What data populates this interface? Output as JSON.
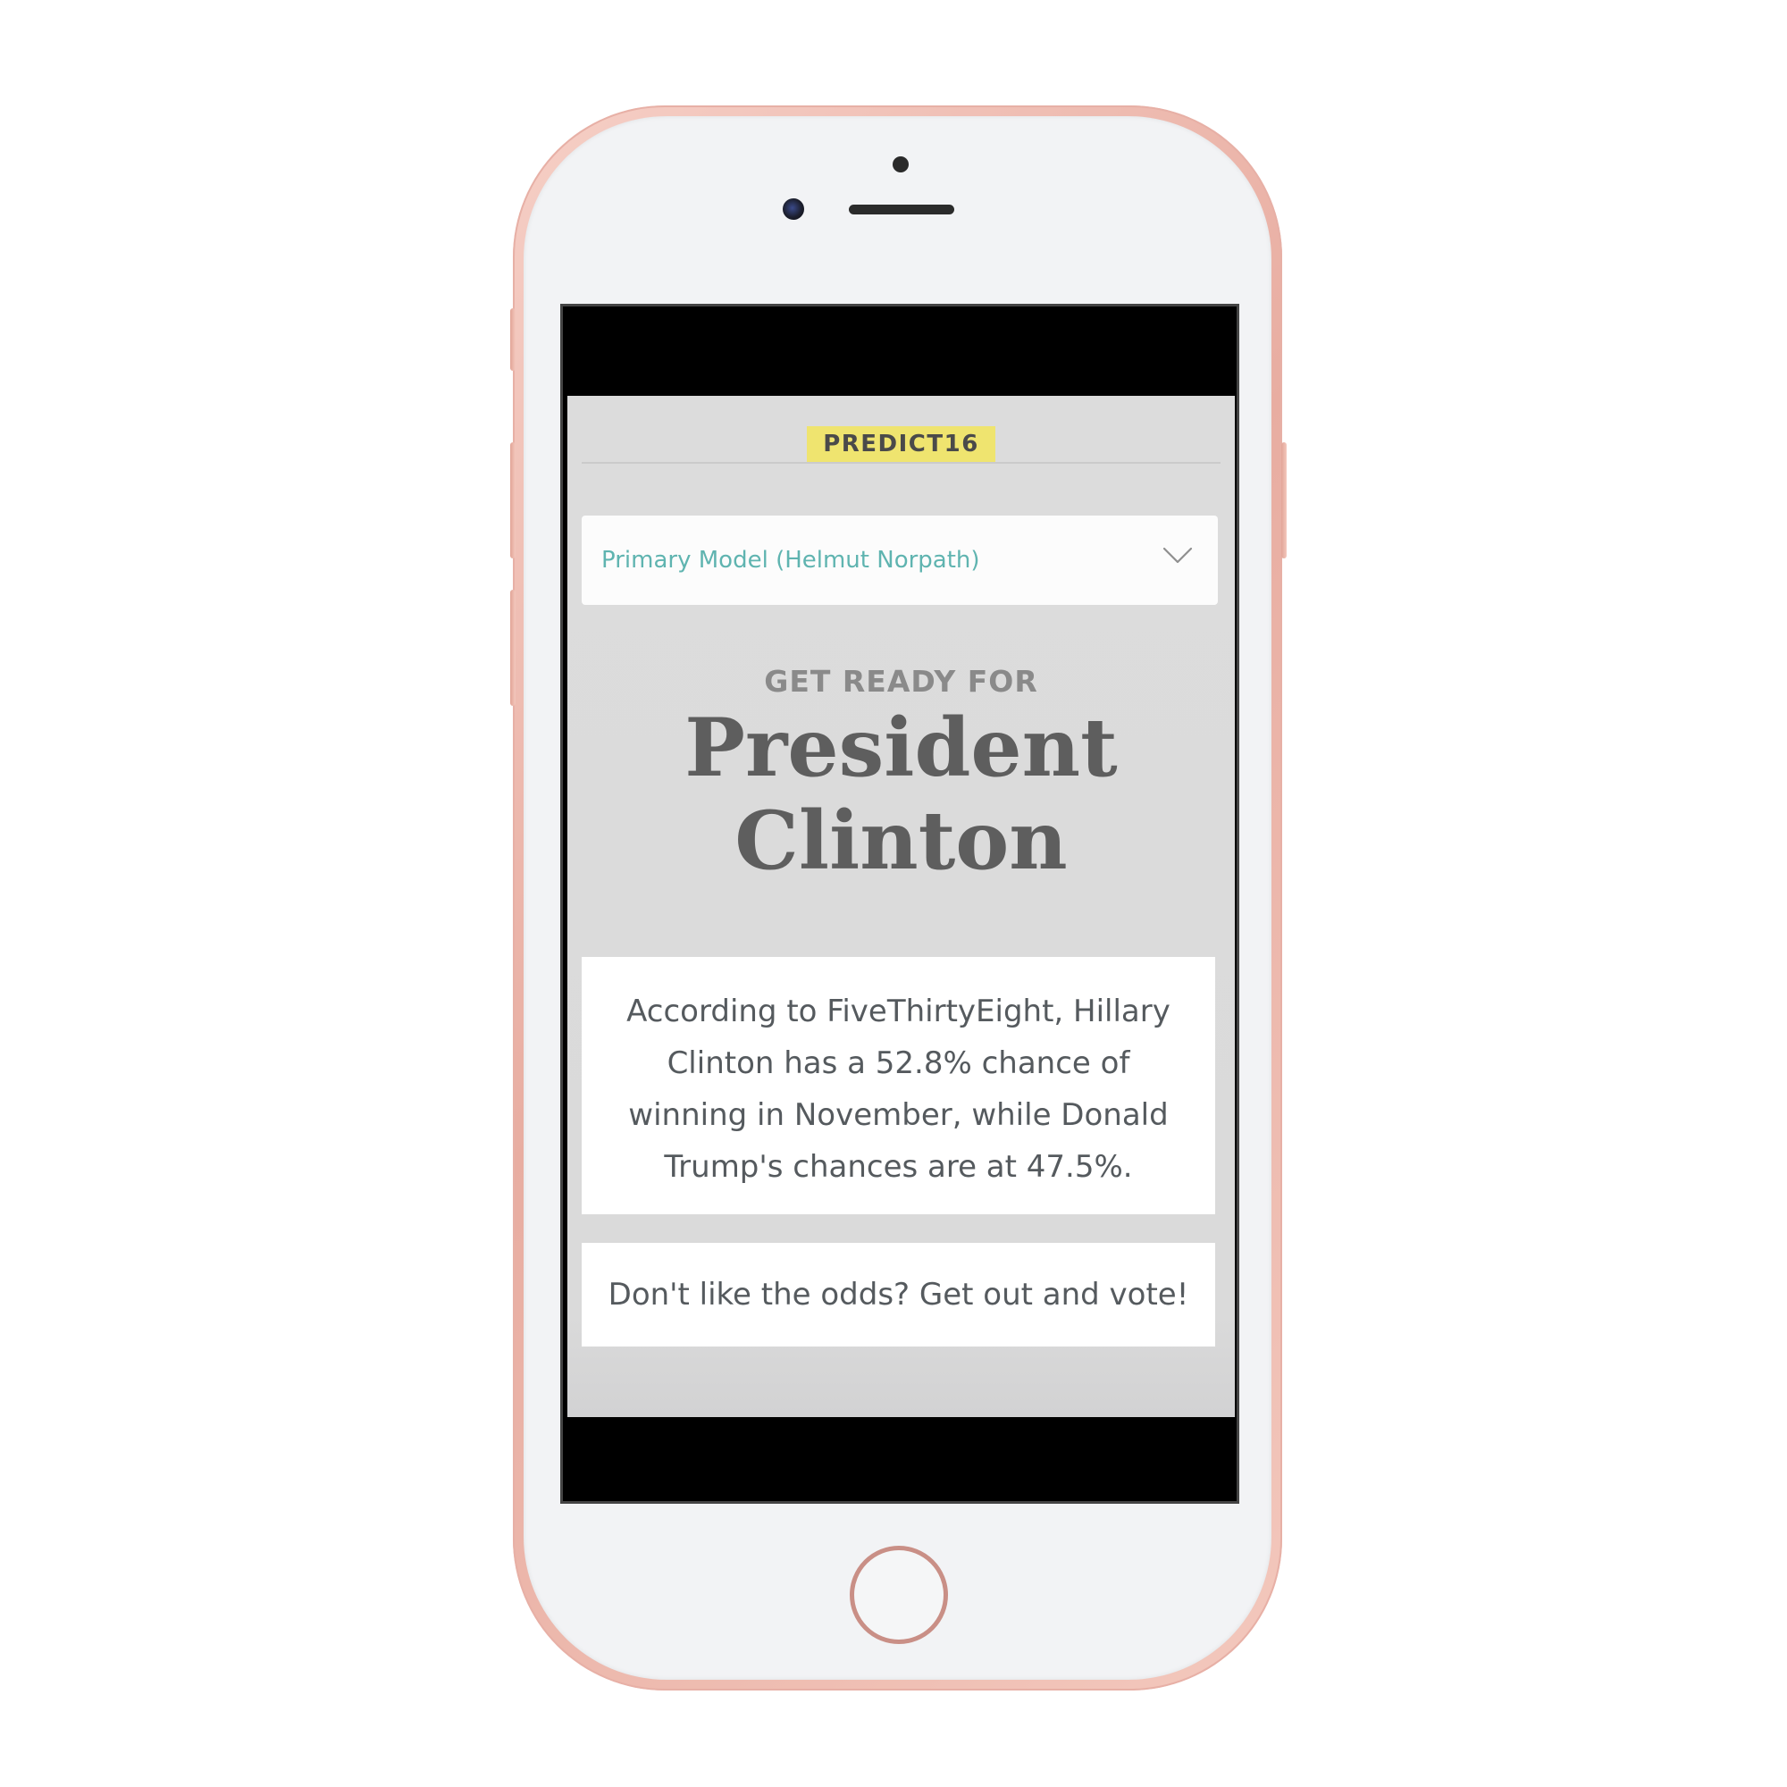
{
  "app": {
    "brand": "PREDICT16",
    "model_select": {
      "value": "Primary Model (Helmut Norpath)"
    },
    "kicker": "GET READY FOR",
    "headline": {
      "line1": "President",
      "line2": "Clinton"
    },
    "odds_text": "According to FiveThirtyEight, Hillary Clinton has a 52.8% chance of winning in November, while Donald Trump's chances are at 47.5%.",
    "cta_text": "Don't like the odds? Get out and vote!"
  },
  "colors": {
    "brand_badge_bg": "#efe46f",
    "select_text": "#5fb4b0",
    "app_background": "#dcdcdc",
    "phone_shell": "#e8ada1"
  },
  "icons": {
    "select_chevron": "chevron-down-icon"
  }
}
